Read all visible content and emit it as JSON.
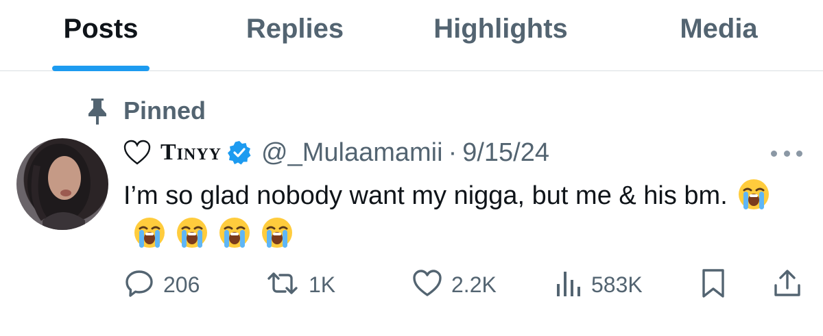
{
  "tabs": [
    {
      "label": "Posts",
      "active": true
    },
    {
      "label": "Replies",
      "active": false
    },
    {
      "label": "Highlights",
      "active": false
    },
    {
      "label": "Media",
      "active": false
    }
  ],
  "pinned": {
    "label": "Pinned"
  },
  "post": {
    "display_name": "Tinyy",
    "handle": "@_Mulaamamii",
    "separator": "·",
    "date": "9/15/24",
    "text": "I’m so glad nobody want my nigga, but me & his bm.",
    "emoji_count": 5,
    "emoji_name": "loudly-crying-face",
    "verified": true
  },
  "actions": {
    "replies": "206",
    "reposts": "1K",
    "likes": "2.2K",
    "views": "583K"
  },
  "colors": {
    "accent": "#1d9bf0",
    "text_primary": "#0f1419",
    "text_secondary": "#536471",
    "divider": "#d9dde1"
  }
}
